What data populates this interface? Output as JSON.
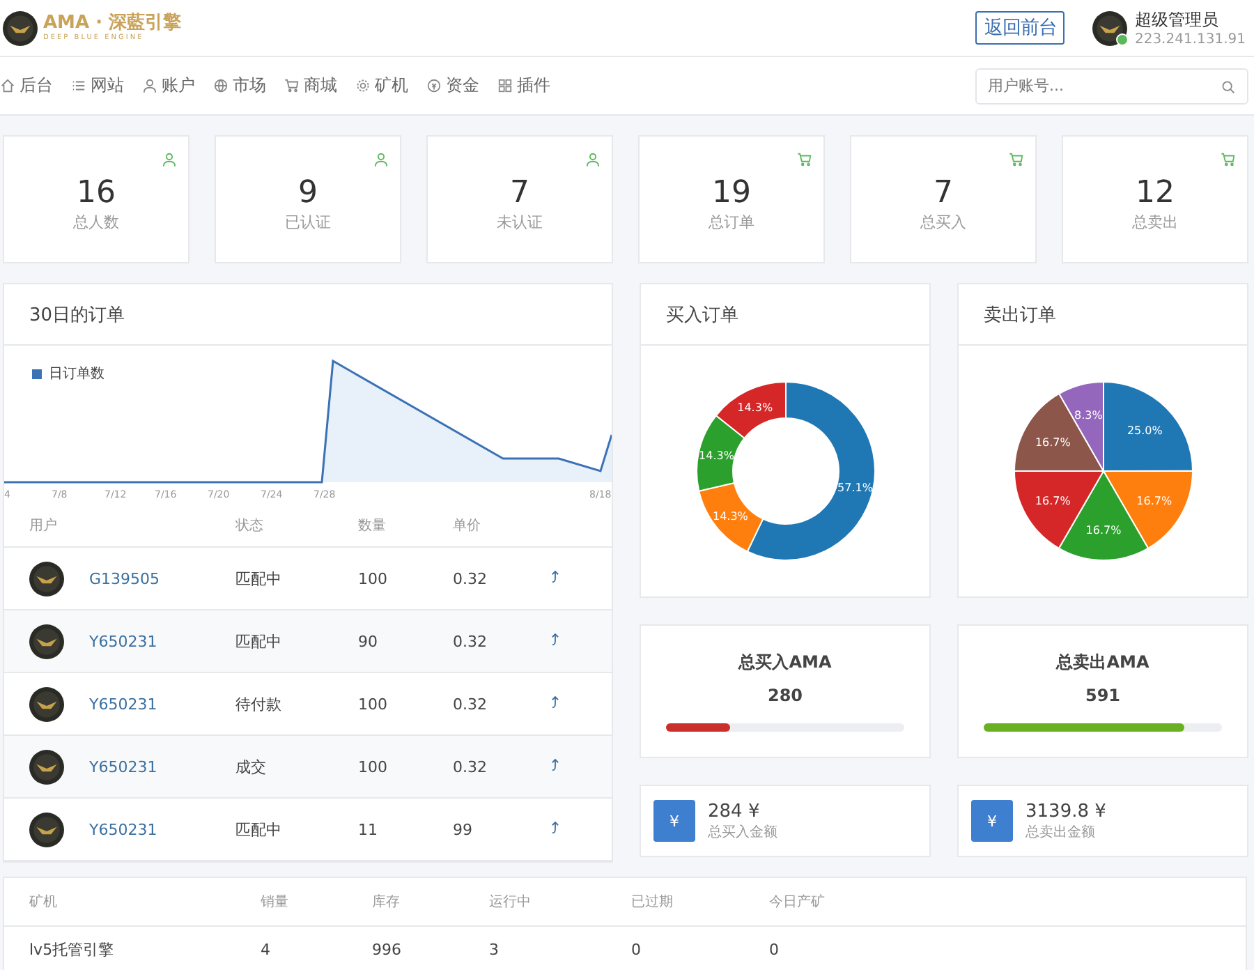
{
  "header": {
    "logo_title": "AMA · 深藍引擎",
    "logo_subtitle": "DEEP BLUE ENGINE",
    "back_button": "返回前台",
    "user_name": "超级管理员",
    "user_ip": "223.241.131.91",
    "online": true
  },
  "nav": {
    "items": [
      {
        "label": "后台",
        "kind": "home"
      },
      {
        "label": "网站",
        "kind": "list"
      },
      {
        "label": "账户",
        "kind": "user"
      },
      {
        "label": "市场",
        "kind": "globe"
      },
      {
        "label": "商城",
        "kind": "cart"
      },
      {
        "label": "矿机",
        "kind": "gear"
      },
      {
        "label": "资金",
        "kind": "coin"
      },
      {
        "label": "插件",
        "kind": "grid"
      }
    ],
    "search": {
      "placeholder": "用户账号..."
    }
  },
  "stats": [
    {
      "value": "16",
      "label": "总人数",
      "kind": "user"
    },
    {
      "value": "9",
      "label": "已认证",
      "kind": "user"
    },
    {
      "value": "7",
      "label": "未认证",
      "kind": "user"
    },
    {
      "value": "19",
      "label": "总订单",
      "kind": "cart"
    },
    {
      "value": "7",
      "label": "总买入",
      "kind": "cart"
    },
    {
      "value": "12",
      "label": "总卖出",
      "kind": "cart"
    }
  ],
  "orders_panel": {
    "title": "30日的订单",
    "legend": "日订单数",
    "x_labels": [
      "4",
      "7/8",
      "7/12",
      "7/16",
      "7/20",
      "7/24",
      "7/28",
      "8/18"
    ],
    "columns": [
      "用户",
      "状态",
      "数量",
      "单价"
    ],
    "rows": [
      {
        "user": "G139505",
        "status": "匹配中",
        "quantity": "100",
        "price": "0.32"
      },
      {
        "user": "Y650231",
        "status": "匹配中",
        "quantity": "90",
        "price": "0.32"
      },
      {
        "user": "Y650231",
        "status": "待付款",
        "quantity": "100",
        "price": "0.32"
      },
      {
        "user": "Y650231",
        "status": "成交",
        "quantity": "100",
        "price": "0.32"
      },
      {
        "user": "Y650231",
        "status": "匹配中",
        "quantity": "11",
        "price": "99"
      }
    ]
  },
  "buy_orders": {
    "title": "买入订单",
    "chart_data": {
      "type": "donut",
      "values": [
        57.1,
        14.3,
        14.3,
        14.3
      ],
      "value_labels": [
        "57.1%",
        "14.3%",
        "14.3%",
        "14.3%"
      ],
      "colors": [
        "#1f77b4",
        "#ff7f0e",
        "#2ca02c",
        "#d62728"
      ]
    }
  },
  "sell_orders": {
    "title": "卖出订单",
    "chart_data": {
      "type": "pie",
      "values": [
        25.0,
        16.7,
        16.7,
        16.7,
        16.7,
        8.3
      ],
      "value_labels": [
        "25.0%",
        "16.7%",
        "16.7%",
        "16.7%",
        "16.7%",
        "8.3%"
      ],
      "colors": [
        "#1f77b4",
        "#ff7f0e",
        "#2ca02c",
        "#d62728",
        "#8c564b",
        "#9467bd"
      ]
    }
  },
  "totals": [
    {
      "title": "总买入AMA",
      "value": "280",
      "level": 0.27,
      "color": "#c9302c"
    },
    {
      "title": "总卖出AMA",
      "value": "591",
      "level": 0.84,
      "color": "#6ab023"
    }
  ],
  "amounts": [
    {
      "icon": "¥",
      "value": "284 ¥",
      "label": "总买入金额"
    },
    {
      "icon": "¥",
      "value": "3139.8 ¥",
      "label": "总卖出金额"
    }
  ],
  "miners": {
    "columns": [
      "矿机",
      "销量",
      "库存",
      "运行中",
      "已过期",
      "今日产矿"
    ],
    "rows": [
      [
        "lv5托管引擎",
        "4",
        "996",
        "3",
        "0",
        "0"
      ]
    ]
  }
}
